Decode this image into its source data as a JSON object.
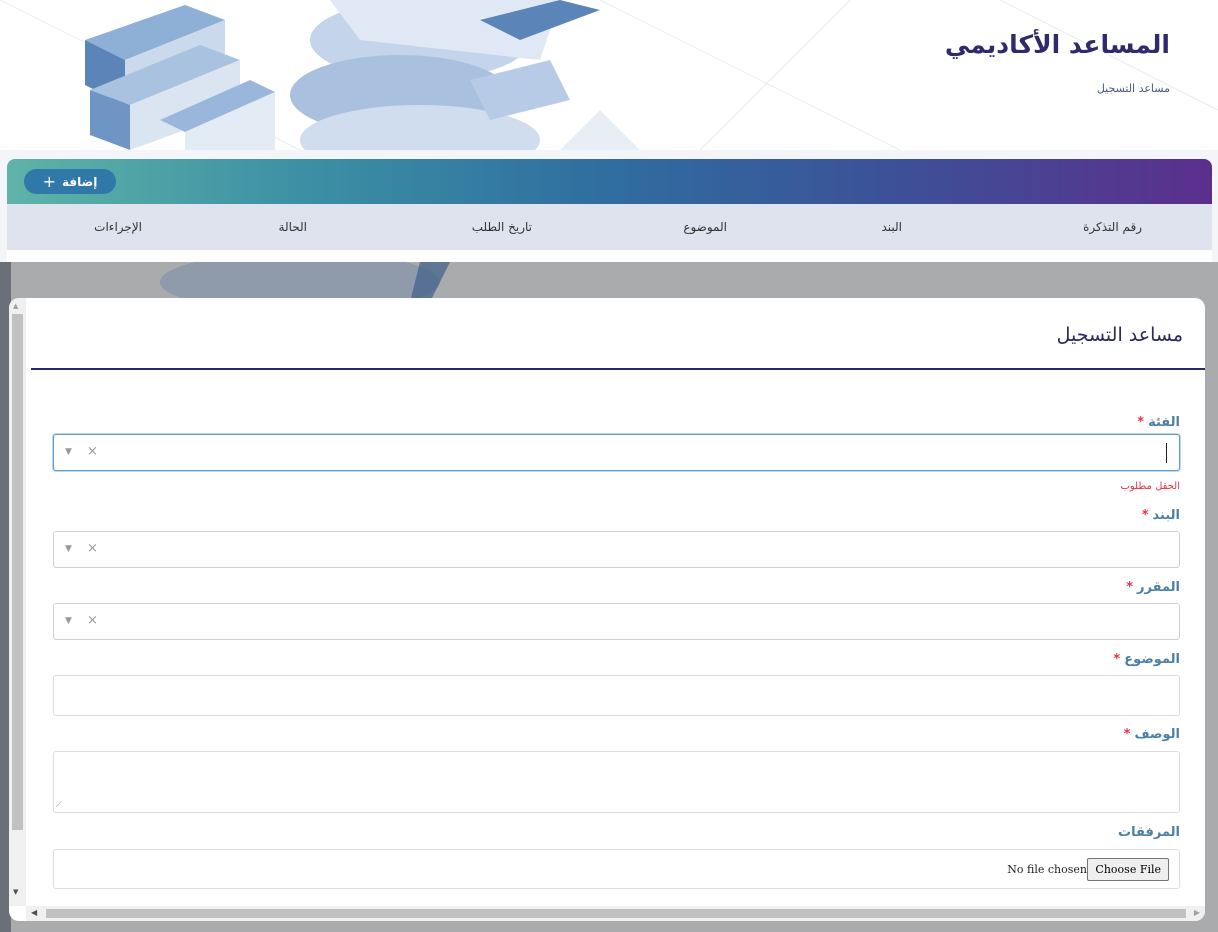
{
  "header": {
    "title": "المساعد الأكاديمي",
    "breadcrumb": "مساعد التسجيل"
  },
  "toolbar": {
    "add_label": "إضافة",
    "add_icon": "plus-icon"
  },
  "table": {
    "columns": [
      "رقم التذكرة",
      "البند",
      "الموضوع",
      "تاريخ الطلب",
      "الحالة",
      "الإجراءات"
    ]
  },
  "modal": {
    "title": "مساعد التسجيل",
    "fields": {
      "category": {
        "label": "الفئة",
        "required": "*",
        "error": "الحقل مطلوب"
      },
      "item": {
        "label": "البند",
        "required": "*"
      },
      "course": {
        "label": "المقرر",
        "required": "*"
      },
      "subject": {
        "label": "الموضوع",
        "required": "*"
      },
      "description": {
        "label": "الوصف",
        "required": "*"
      },
      "attachments": {
        "label": "المرفقات",
        "button": "Choose File",
        "status": "No file chosen"
      }
    }
  },
  "colors": {
    "title": "#2f2a6b",
    "label": "#4a7fa6",
    "required": "#e0334a",
    "gradient_start": "#5fb3a8",
    "gradient_end": "#5c2f8d"
  }
}
